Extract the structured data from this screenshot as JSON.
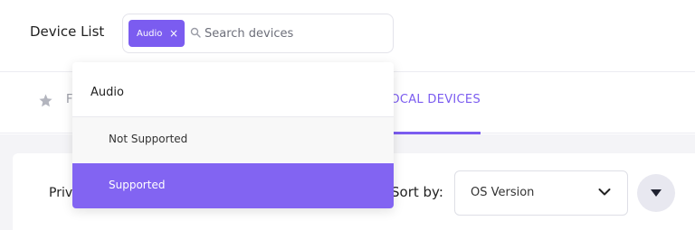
{
  "header": {
    "title": "Device List",
    "search": {
      "chip_label": "Audio",
      "chip_close": "×",
      "placeholder": "Search devices",
      "value": ""
    }
  },
  "tabs": {
    "favorites_label": "F",
    "local_devices_label": "OCAL DEVICES"
  },
  "toolbar": {
    "privacy_label": "Priv",
    "sort_label": "Sort by:",
    "sort_value": "OS Version"
  },
  "dropdown": {
    "group_label": "Audio",
    "options": [
      {
        "label": "Not Supported",
        "selected": false
      },
      {
        "label": "Supported",
        "selected": true
      }
    ]
  },
  "colors": {
    "accent": "#7b5cf0",
    "selected_option": "#8264f2",
    "content_bg": "#f4f4f7"
  },
  "icons": [
    "close-icon",
    "search-icon",
    "star-icon",
    "chevron-down-icon",
    "caret-down-icon"
  ]
}
